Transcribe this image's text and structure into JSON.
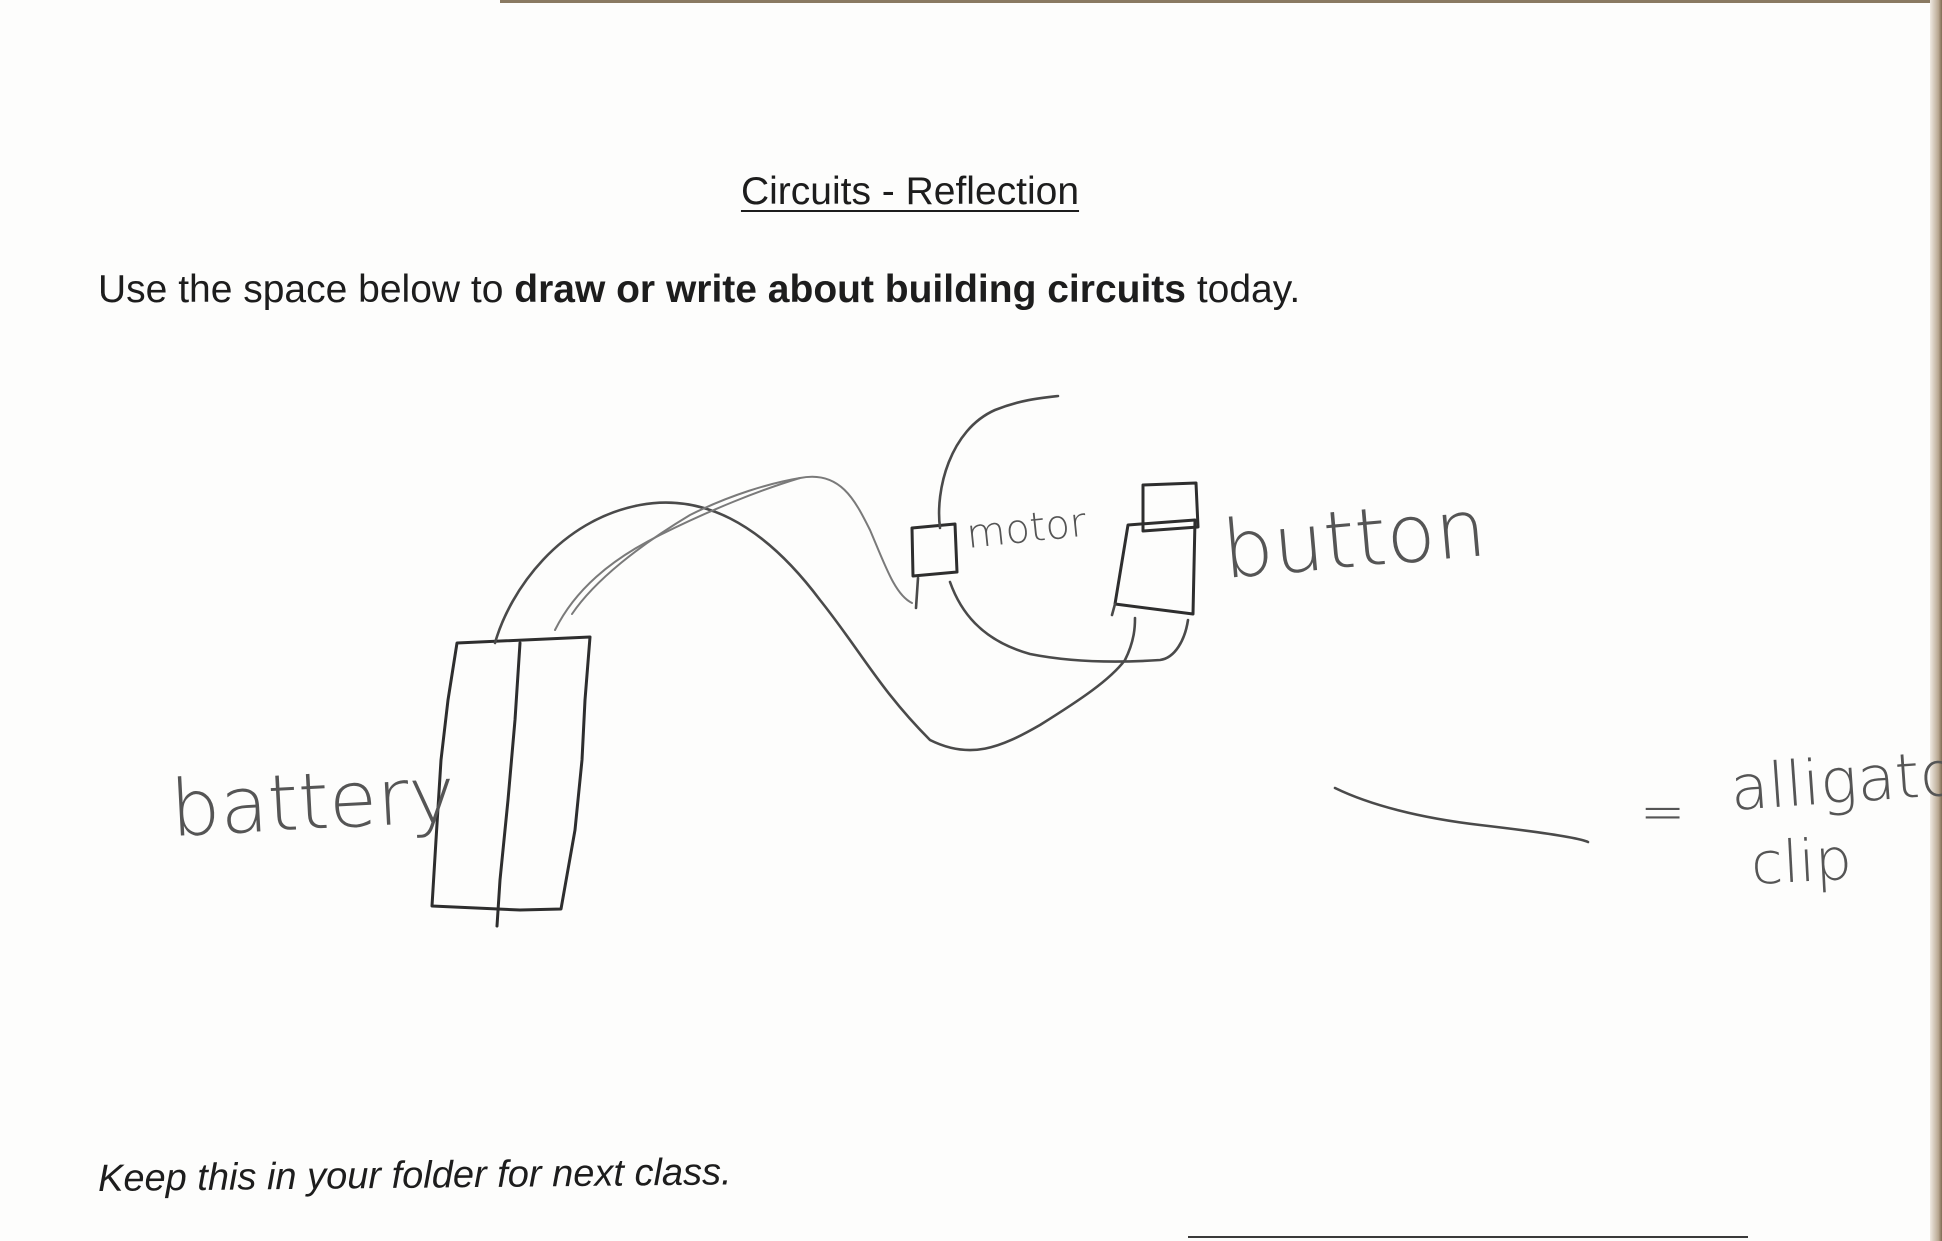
{
  "worksheet": {
    "title": "Circuits - Reflection",
    "instructions": {
      "before": "Use the space below to ",
      "emphasis": "draw or write about building circuits",
      "after": " today."
    },
    "footer_note": "Keep this in your folder for next class."
  },
  "drawing_labels": {
    "battery": "battery",
    "motor": "motor",
    "button": "button",
    "legend_equals": "=",
    "legend_line_1": "alligator",
    "legend_line_2": "clip"
  }
}
